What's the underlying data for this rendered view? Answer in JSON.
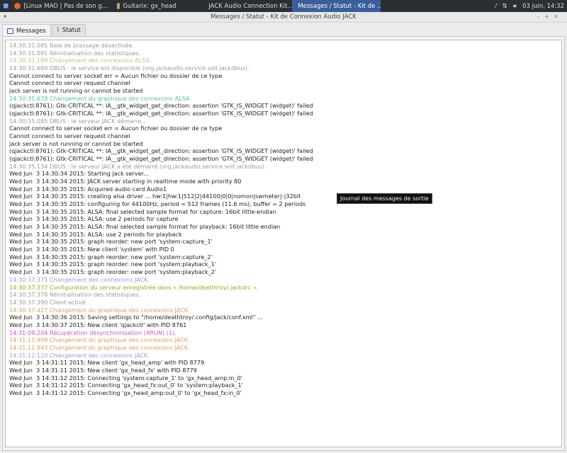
{
  "taskbar": {
    "items": [
      {
        "label": "[Linux MAO | Pas de son g...",
        "icon": "firefox-icon",
        "active": false
      },
      {
        "label": "Guitarix: gx_head",
        "icon": "guitar-icon",
        "active": false
      },
      {
        "label": "JACK Audio Connection Kit...",
        "icon": "qjackctl-icon",
        "active": false
      },
      {
        "label": "Messages / Statut - Kit de ...",
        "icon": "messages-icon",
        "active": true
      }
    ],
    "clock": "03 juin, 14:32"
  },
  "window": {
    "title": "Messages / Statut - Kit de Connexion Audio JACK"
  },
  "tabs": [
    {
      "label": "Messages",
      "active": true
    },
    {
      "label": "Statut",
      "active": false
    }
  ],
  "colors": {
    "info": "#9a9a9a",
    "alsa": "#c4c08a",
    "alsagraph": "#55c48c",
    "jack": "#9a9ad8",
    "config": "#a8a020",
    "graph": "#d8a060",
    "xrun": "#d050d0",
    "out": "#222222"
  },
  "log": [
    {
      "text": "14:30:31.085 Baie de brassage désactivée.",
      "kind": "info"
    },
    {
      "text": "14:30:31.091 Réinitialisation des statistiques.",
      "kind": "info"
    },
    {
      "text": "14:30:31.189 Changement des connexions ALSA.",
      "kind": "alsa"
    },
    {
      "text": "14:30:31.660 DBUS : le service est disponible (org.jackaudio.service soit jackdbus).",
      "kind": "info"
    },
    {
      "text": "Cannot connect to server socket err = Aucun fichier ou dossier de ce type",
      "kind": "out"
    },
    {
      "text": "Cannot connect to server request channel",
      "kind": "out"
    },
    {
      "text": "jack server is not running or cannot be started",
      "kind": "out"
    },
    {
      "text": "14:30:31.678 Changement du graphique des connexions ALSA.",
      "kind": "alsagraph"
    },
    {
      "text": "(qjackctl:8761): Gtk-CRITICAL **: IA__gtk_widget_get_direction: assertion 'GTK_IS_WIDGET (widget)' failed",
      "kind": "out"
    },
    {
      "text": "(qjackctl:8761): Gtk-CRITICAL **: IA__gtk_widget_get_direction: assertion 'GTK_IS_WIDGET (widget)' failed",
      "kind": "out"
    },
    {
      "text": "14:30:35.085 DBUS : le serveur JACK démarre...",
      "kind": "info"
    },
    {
      "text": "Cannot connect to server socket err = Aucun fichier ou dossier de ce type",
      "kind": "out"
    },
    {
      "text": "Cannot connect to server request channel",
      "kind": "out"
    },
    {
      "text": "jack server is not running or cannot be started",
      "kind": "out"
    },
    {
      "text": "(qjackctl:8761): Gtk-CRITICAL **: IA__gtk_widget_get_direction: assertion 'GTK_IS_WIDGET (widget)' failed",
      "kind": "out"
    },
    {
      "text": "(qjackctl:8761): Gtk-CRITICAL **: IA__gtk_widget_get_direction: assertion 'GTK_IS_WIDGET (widget)' failed",
      "kind": "out"
    },
    {
      "text": "14:30:35.134 DBUS : le serveur JACK a été démarré (org.jackaudio.service soit jackdbus).",
      "kind": "info"
    },
    {
      "text": "Wed Jun  3 14:30:34 2015: Starting jack server...",
      "kind": "out"
    },
    {
      "text": "Wed Jun  3 14:30:34 2015: JACK server starting in realtime mode with priority 80",
      "kind": "out"
    },
    {
      "text": "Wed Jun  3 14:30:35 2015: Acquired audio card Audio1",
      "kind": "out"
    },
    {
      "text": "Wed Jun  3 14:30:35 2015: creating alsa driver ... hw:1|hw:1|512|2|44100|0|0|nomon|swmeter|-|32bit",
      "kind": "out"
    },
    {
      "text": "Wed Jun  3 14:30:35 2015: configuring for 44100Hz, period = 512 frames (11.6 ms), buffer = 2 periods",
      "kind": "out"
    },
    {
      "text": "Wed Jun  3 14:30:35 2015: ALSA: final selected sample format for capture: 16bit little-endian",
      "kind": "out"
    },
    {
      "text": "Wed Jun  3 14:30:35 2015: ALSA: use 2 periods for capture",
      "kind": "out"
    },
    {
      "text": "Wed Jun  3 14:30:35 2015: ALSA: final selected sample format for playback: 16bit little-endian",
      "kind": "out"
    },
    {
      "text": "Wed Jun  3 14:30:35 2015: ALSA: use 2 periods for playback",
      "kind": "out"
    },
    {
      "text": "Wed Jun  3 14:30:35 2015: graph reorder: new port 'system:capture_1'",
      "kind": "out"
    },
    {
      "text": "Wed Jun  3 14:30:35 2015: New client 'system' with PID 0",
      "kind": "out"
    },
    {
      "text": "Wed Jun  3 14:30:35 2015: graph reorder: new port 'system:capture_2'",
      "kind": "out"
    },
    {
      "text": "Wed Jun  3 14:30:35 2015: graph reorder: new port 'system:playback_1'",
      "kind": "out"
    },
    {
      "text": "Wed Jun  3 14:30:35 2015: graph reorder: new port 'system:playback_2'",
      "kind": "out"
    },
    {
      "text": "14:30:37.375 Changement des connexions JACK.",
      "kind": "jack"
    },
    {
      "text": "14:30:37.377 Configuration du serveur enregistrée dans « /home/deathtroy/.jackdrc ».",
      "kind": "config"
    },
    {
      "text": "14:30:37.378 Réinitialisation des statistiques.",
      "kind": "info"
    },
    {
      "text": "14:30:37.390 Client activé.",
      "kind": "info"
    },
    {
      "text": "14:30:37.427 Changement du graphique des connexions JACK.",
      "kind": "graph"
    },
    {
      "text": "Wed Jun  3 14:30:36 2015: Saving settings to \"/home/deathtroy/.config/jack/conf.xml\" ...",
      "kind": "out"
    },
    {
      "text": "Wed Jun  3 14:30:37 2015: New client 'qjackctl' with PID 8761",
      "kind": "out"
    },
    {
      "text": "14:31:09.204 Récupération désynchronisation (XRUN) (1).",
      "kind": "xrun"
    },
    {
      "text": "14:31:11.909 Changement du graphique des connexions JACK.",
      "kind": "graph"
    },
    {
      "text": "14:31:11.943 Changement du graphique des connexions JACK.",
      "kind": "graph"
    },
    {
      "text": "14:31:12.120 Changement des connexions JACK.",
      "kind": "jack"
    },
    {
      "text": "Wed Jun  3 14:31:11 2015: New client 'gx_head_amp' with PID 8779",
      "kind": "out"
    },
    {
      "text": "Wed Jun  3 14:31:11 2015: New client 'gx_head_fx' with PID 8779",
      "kind": "out"
    },
    {
      "text": "Wed Jun  3 14:31:12 2015: Connecting 'system:capture_1' to 'gx_head_amp:in_0'",
      "kind": "out"
    },
    {
      "text": "Wed Jun  3 14:31:12 2015: Connecting 'gx_head_fx:out_0' to 'system:playback_1'",
      "kind": "out"
    },
    {
      "text": "Wed Jun  3 14:31:12 2015: Connecting 'gx_head_amp:out_0' to 'gx_head_fx:in_0'",
      "kind": "out"
    }
  ],
  "tooltip": "Journal des messages de sortie"
}
